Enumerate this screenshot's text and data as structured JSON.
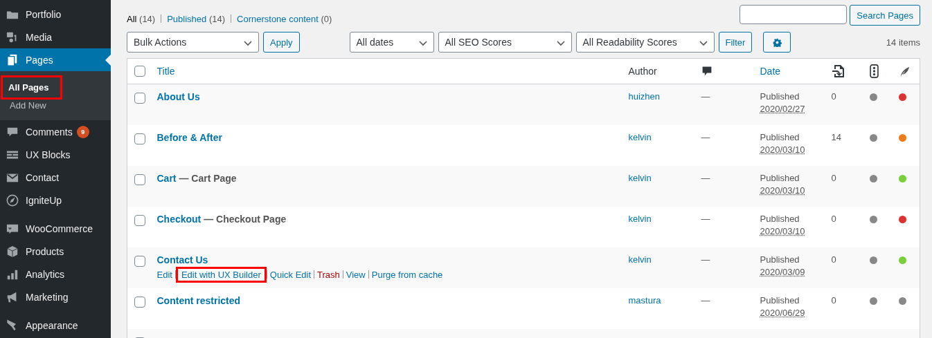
{
  "sidebar": {
    "sections": [
      [
        {
          "label": "Portfolio",
          "selected": false
        },
        {
          "label": "Media",
          "selected": false
        },
        {
          "label": "Pages",
          "selected": true,
          "submenu": [
            {
              "label": "All Pages",
              "selected": true,
              "highlighted": true
            },
            {
              "label": "Add New",
              "selected": false,
              "highlighted": false
            }
          ]
        },
        {
          "label": "Comments",
          "selected": false,
          "badge": "9"
        },
        {
          "label": "UX Blocks",
          "selected": false
        },
        {
          "label": "Contact",
          "selected": false
        },
        {
          "label": "IgniteUp",
          "selected": false
        }
      ],
      [
        {
          "label": "WooCommerce",
          "selected": false
        },
        {
          "label": "Products",
          "selected": false
        },
        {
          "label": "Analytics",
          "selected": false
        },
        {
          "label": "Marketing",
          "selected": false
        }
      ],
      [
        {
          "label": "Appearance",
          "selected": false
        }
      ]
    ]
  },
  "views": [
    {
      "label": "All",
      "count": "(14)",
      "selected": true
    },
    {
      "label": "Published",
      "count": "(14)",
      "selected": false
    },
    {
      "label": "Cornerstone content",
      "count": "(0)",
      "selected": false
    }
  ],
  "search": {
    "button": "Search Pages"
  },
  "tablenav": {
    "bulk": "Bulk Actions",
    "apply": "Apply",
    "filters": [
      "All dates",
      "All SEO Scores",
      "All Readability Scores"
    ],
    "filter_button": "Filter",
    "count": "14 items"
  },
  "table": {
    "columns": {
      "title": "Title",
      "author": "Author",
      "date": "Date"
    },
    "select_all_checked": false,
    "partial_row": {
      "checked": false
    },
    "rows": [
      {
        "title": "About Us",
        "checked": false,
        "author": "huizhen",
        "comments": "—",
        "status": "Published",
        "date": "2020/02/27",
        "links": "0",
        "scores": [
          {
            "color": "#888888"
          },
          {
            "color": "#dc3232"
          }
        ]
      },
      {
        "title": "Before & After",
        "checked": false,
        "author": "kelvin",
        "comments": "—",
        "status": "Published",
        "date": "2020/03/10",
        "links": "14",
        "scores": [
          {
            "color": "#888888"
          },
          {
            "color": "#ee7c1b"
          }
        ]
      },
      {
        "title": "Cart",
        "suffix": " — Cart Page",
        "checked": false,
        "author": "kelvin",
        "comments": "—",
        "status": "Published",
        "date": "2020/03/10",
        "links": "0",
        "scores": [
          {
            "color": "#888888"
          },
          {
            "color": "#7ad03a"
          }
        ]
      },
      {
        "title": "Checkout",
        "suffix": " — Checkout Page",
        "checked": false,
        "author": "kelvin",
        "comments": "—",
        "status": "Published",
        "date": "2020/03/10",
        "links": "0",
        "scores": [
          {
            "color": "#888888"
          },
          {
            "color": "#dc3232"
          }
        ]
      },
      {
        "title": "Contact Us",
        "checked": false,
        "author": "kelvin",
        "comments": "—",
        "status": "Published",
        "date": "2020/03/09",
        "links": "0",
        "scores": [
          {
            "color": "#888888"
          },
          {
            "color": "#7ad03a"
          }
        ],
        "actions": [
          {
            "label": "Edit",
            "kind": "link",
            "highlighted": false
          },
          {
            "label": "Edit with UX Builder",
            "kind": "link",
            "highlighted": true
          },
          {
            "label": "Quick Edit",
            "kind": "link",
            "highlighted": false
          },
          {
            "label": "Trash",
            "kind": "danger",
            "highlighted": false
          },
          {
            "label": "View",
            "kind": "link",
            "highlighted": false
          },
          {
            "label": "Purge from cache",
            "kind": "link",
            "highlighted": false
          }
        ]
      },
      {
        "title": "Content restricted",
        "checked": false,
        "author": "mastura",
        "comments": "—",
        "status": "Published",
        "date": "2020/06/29",
        "links": "0",
        "scores": [
          {
            "color": "#888888"
          },
          {
            "color": "#888888"
          }
        ]
      }
    ]
  }
}
